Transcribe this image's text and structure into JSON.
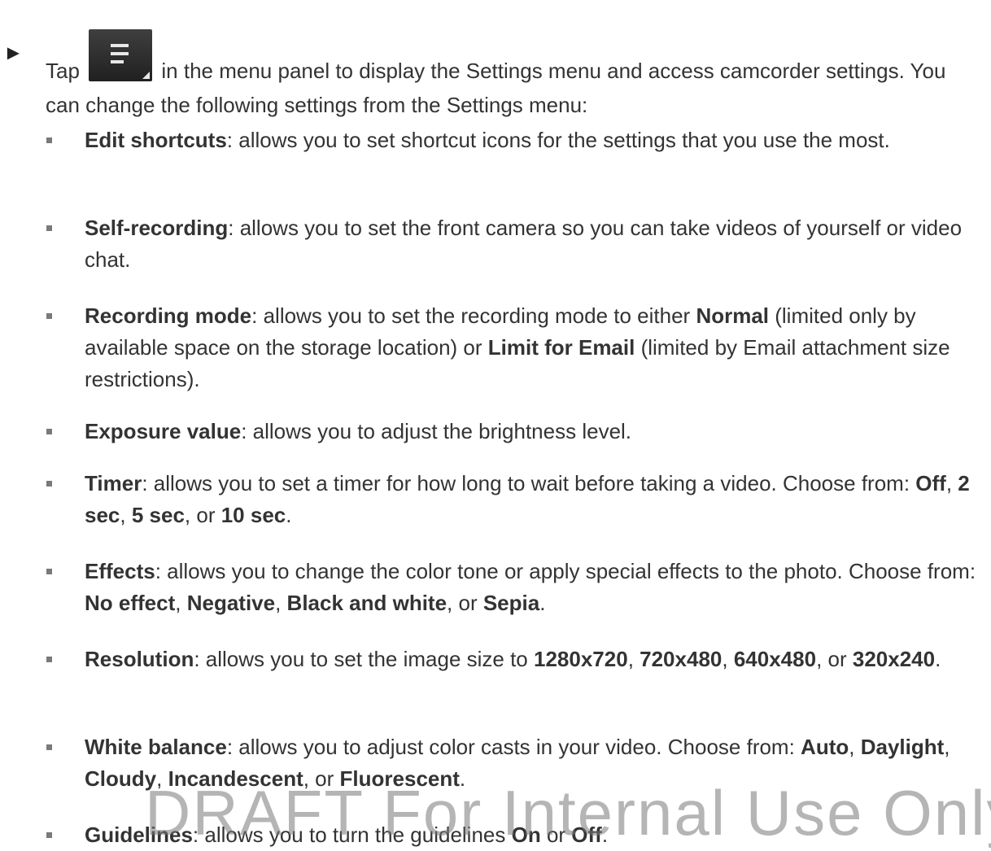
{
  "intro": {
    "arrow": "►",
    "tap": "Tap",
    "rest": "in the menu panel to display the Settings menu and access camcorder settings. You can change the following settings from the Settings menu:",
    "icon": "settings-menu-icon"
  },
  "items": [
    {
      "term": "Edit shortcuts",
      "desc": ": allows you to set shortcut icons for the settings that you use the most."
    },
    {
      "term": "Self-recording",
      "desc": ": allows you to set the front camera so you can take videos of yourself or video chat."
    },
    {
      "term": "Recording mode",
      "d1": ": allows you to set the recording mode to either ",
      "o1": "Normal",
      "d2": " (limited only by available space on the storage location) or ",
      "o2": "Limit for Email",
      "d3": " (limited by Email attachment size restrictions)."
    },
    {
      "term": "Exposure value",
      "desc": ": allows you to adjust the brightness level."
    },
    {
      "term": "Timer",
      "d1": ": allows you to set a timer for how long to wait before taking a video. Choose from: ",
      "o1": "Off",
      "s1": ", ",
      "o2": "2 sec",
      "s2": ", ",
      "o3": "5 sec",
      "s3": ", or ",
      "o4": "10 sec",
      "end": "."
    },
    {
      "term": "Effects",
      "d1": ": allows you to change the color tone or apply special effects to the photo. Choose from: ",
      "o1": "No effect",
      "s1": ", ",
      "o2": "Negative",
      "s2": ", ",
      "o3": "Black and white",
      "s3": ", or ",
      "o4": "Sepia",
      "end": "."
    },
    {
      "term": "Resolution",
      "d1": ": allows you to set the image size to ",
      "o1": "1280x720",
      "s1": ", ",
      "o2": "720x480",
      "s2": ", ",
      "o3": "640x480",
      "s3": ", or ",
      "o4": "320x240",
      "end": "."
    },
    {
      "term": "White balance",
      "d1": ": allows you to adjust color casts in your video. Choose from: ",
      "o1": "Auto",
      "s1": ", ",
      "o2": "Daylight",
      "s2": ", ",
      "o3": "Cloudy",
      "s3": ", ",
      "o4": "Incandescent",
      "s4": ", or ",
      "o5": "Fluorescent",
      "end": "."
    },
    {
      "term": "Guidelines",
      "d1": ": allows you to turn the guidelines ",
      "o1": "On",
      "s1": " or ",
      "o2": "Off",
      "end": "."
    }
  ],
  "watermark": "DRAFT For Internal Use Only"
}
